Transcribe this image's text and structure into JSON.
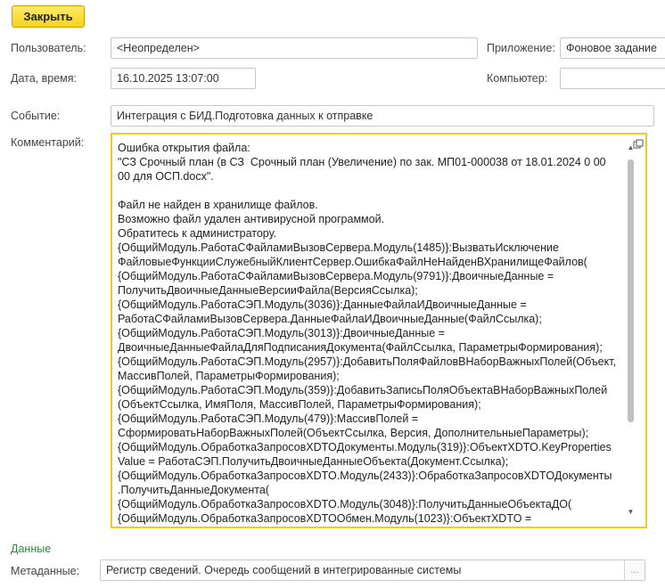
{
  "toolbar": {
    "close_label": "Закрыть"
  },
  "fields": {
    "user": {
      "label": "Пользователь:",
      "value": "<Неопределен>"
    },
    "app": {
      "label": "Приложение:",
      "value": "Фоновое задание"
    },
    "datetime": {
      "label": "Дата, время:",
      "value": "16.10.2025 13:07:00"
    },
    "computer": {
      "label": "Компьютер:",
      "value": ""
    },
    "event": {
      "label": "Событие:",
      "value": "Интеграция с БИД.Подготовка данных к отправке"
    },
    "comment": {
      "label": "Комментарий:",
      "lines": [
        "Ошибка открытия файла:",
        "\"СЗ Срочный план (в СЗ  Срочный план (Увеличение) по зак. МП01-000038 от 18.01.2024 0 00",
        "00 для ОСП.docx\".",
        "",
        "Файл не найден в хранилище файлов.",
        "Возможно файл удален антивирусной программой.",
        "Обратитесь к администратору.",
        "{ОбщийМодуль.РаботаСФайламиВызовСервера.Модуль(1485)}:ВызватьИсключение",
        "ФайловыеФункцииСлужебныйКлиентСервер.ОшибкаФайлНеНайденВХранилищеФайлов(",
        "{ОбщийМодуль.РаботаСФайламиВызовСервера.Модуль(9791)}:ДвоичныеДанные =",
        "ПолучитьДвоичныеДанныеВерсииФайла(ВерсияСсылка);",
        "{ОбщийМодуль.РаботаСЭП.Модуль(3036)}:ДанныеФайлаИДвоичныеДанные =",
        "РаботаСФайламиВызовСервера.ДанныеФайлаИДвоичныеДанные(ФайлСсылка);",
        "{ОбщийМодуль.РаботаСЭП.Модуль(3013)}:ДвоичныеДанные =",
        "ДвоичныеДанныеФайлаДляПодписанияДокумента(ФайлСсылка, ПараметрыФормирования);",
        "{ОбщийМодуль.РаботаСЭП.Модуль(2957)}:ДобавитьПоляФайловВНаборВажныхПолей(Объект,",
        "МассивПолей, ПараметрыФормирования);",
        "{ОбщийМодуль.РаботаСЭП.Модуль(359)}:ДобавитьЗаписьПоляОбъектаВНаборВажныхПолей",
        "(ОбъектСсылка, ИмяПоля, МассивПолей, ПараметрыФормирования);",
        "{ОбщийМодуль.РаботаСЭП.Модуль(479)}:МассивПолей =",
        "СформироватьНаборВажныхПолей(ОбъектСсылка, Версия, ДополнительныеПараметры);",
        "{ОбщийМодуль.ОбработкаЗапросовXDTOДокументы.Модуль(319)}:ОбъектXDTO.KeyProperties",
        "Value = РаботаСЭП.ПолучитьДвоичныеДанныеОбъекта(Документ.Ссылка);",
        "{ОбщийМодуль.ОбработкаЗапросовXDTO.Модуль(2433)}:ОбработкаЗапросовXDTOДокументы",
        ".ПолучитьДанныеДокумента(",
        "{ОбщийМодуль.ОбработкаЗапросовXDTO.Модуль(3048)}:ПолучитьДанныеОбъектаДО(",
        "{ОбщийМодуль.ОбработкаЗапросовXDTOОбмен.Модуль(1023)}:ОбъектXDTO ="
      ]
    }
  },
  "data_section": {
    "title": "Данные",
    "metadata": {
      "label": "Метаданные:",
      "value": "Регистр сведений. Очередь сообщений в интегрированные системы"
    }
  },
  "icons": {
    "popout": "popout-icon",
    "scroll_up": "scroll-up-icon",
    "scroll_down": "scroll-down-icon",
    "select": "ellipsis-icon"
  },
  "colors": {
    "close_button": "#f5d31a",
    "focus_border": "#f0c92a",
    "section_title": "#2e8b3e"
  }
}
